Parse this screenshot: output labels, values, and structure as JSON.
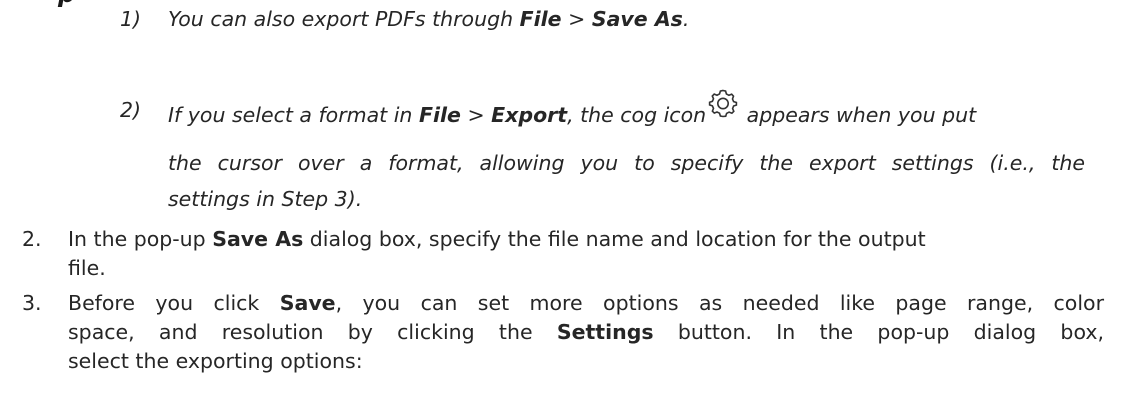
{
  "heading_fragment": "p",
  "tips": [
    {
      "number": "1)",
      "text_before": "You can also export PDFs through ",
      "menu_a": "File",
      "sep": ">",
      "menu_b": "Save As",
      "text_after": "."
    },
    {
      "number": "2)",
      "line1_before": "If you select a format in ",
      "menu_a": "File",
      "sep": ">",
      "menu_b": "Export",
      "line1_mid": ", the cog icon",
      "icon": "cog-icon",
      "line1_after": "appears when you put",
      "line2": "the cursor over a format, allowing you to specify the export settings (i.e., the",
      "line3": "settings in Step 3)."
    }
  ],
  "steps": [
    {
      "number": "2.",
      "before": "In the pop-up ",
      "bold": "Save As",
      "line1_after": " dialog box, specify the file name and location for the output",
      "line2": "file."
    },
    {
      "number": "3.",
      "line1_before": "Before you click ",
      "bold1": "Save",
      "line1_after": ", you can set more options as needed like page range, color",
      "line2_before": "space, and resolution by clicking the ",
      "bold2": "Settings",
      "line2_after": " button. In the pop-up dialog box,",
      "line3": "select the exporting options:"
    }
  ]
}
